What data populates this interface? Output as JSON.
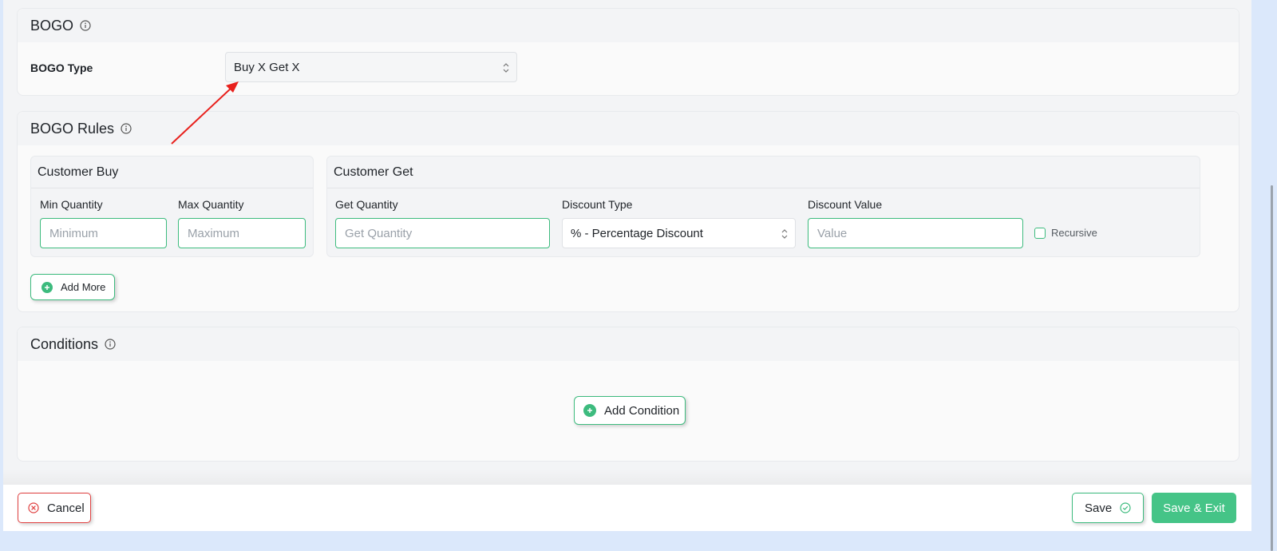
{
  "bogo": {
    "title": "BOGO",
    "type_label": "BOGO Type",
    "type_value": "Buy X Get X"
  },
  "rules": {
    "title": "BOGO Rules",
    "customer_buy": {
      "title": "Customer Buy",
      "min_label": "Min Quantity",
      "min_placeholder": "Minimum",
      "max_label": "Max Quantity",
      "max_placeholder": "Maximum"
    },
    "customer_get": {
      "title": "Customer Get",
      "qty_label": "Get Quantity",
      "qty_placeholder": "Get Quantity",
      "discount_type_label": "Discount Type",
      "discount_type_value": "% - Percentage Discount",
      "discount_value_label": "Discount Value",
      "discount_value_placeholder": "Value",
      "recursive_label": "Recursive"
    },
    "add_more_label": "Add More"
  },
  "conditions": {
    "title": "Conditions",
    "add_condition_label": "Add Condition"
  },
  "footer": {
    "cancel_label": "Cancel",
    "save_label": "Save",
    "save_exit_label": "Save & Exit"
  },
  "colors": {
    "accent_green": "#3dbb7e",
    "danger_red": "#e04040",
    "annotation_arrow": "#e8201c"
  }
}
